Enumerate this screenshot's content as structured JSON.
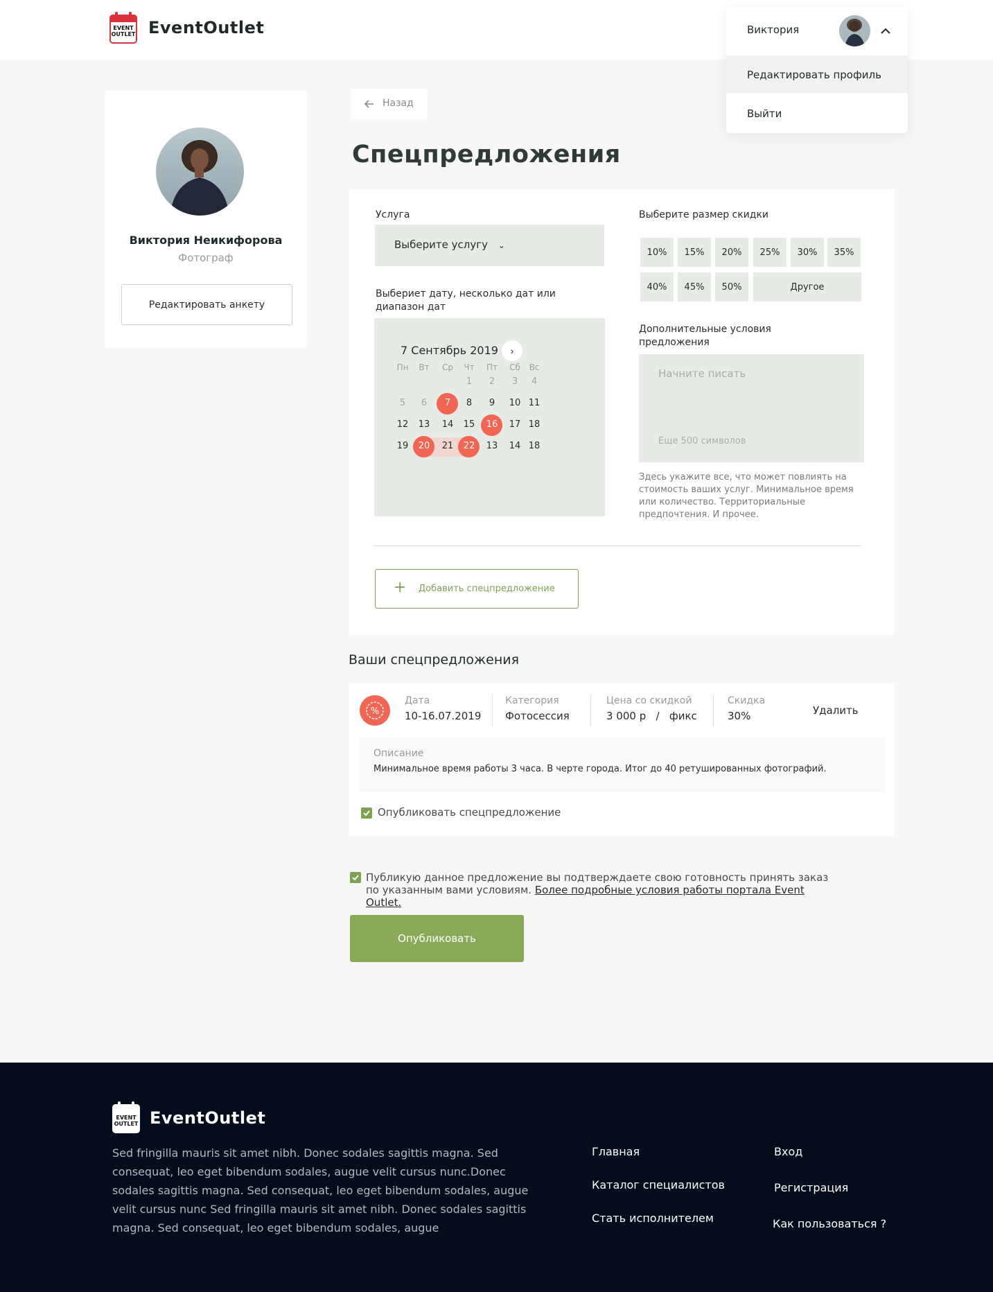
{
  "header": {
    "logo_text": "EventOutlet",
    "logo_badge": "EVENT OUTLET"
  },
  "profile_menu": {
    "name": "Виктория",
    "items": [
      "Редактировать профиль",
      "Выйти"
    ]
  },
  "sidebar": {
    "name": "Виктория Неикифорова",
    "role": "Фотограф",
    "edit_button": "Редактировать анкету"
  },
  "back_label": "Назад",
  "page_title": "Спецпредложения",
  "form": {
    "service_label": "Услуга",
    "service_placeholder": "Выберите услугу",
    "date_label": "Выбериет дату, несколько дат или диапазон дат",
    "calendar": {
      "title": "7 Сентябрь 2019",
      "weekdays": [
        "Пн",
        "Вт",
        "Ср",
        "Чт",
        "Пт",
        "Сб",
        "Вс"
      ],
      "rows": [
        [
          "",
          "",
          "",
          "1",
          "2",
          "3",
          "4"
        ],
        [
          "5",
          "6",
          "7",
          "8",
          "9",
          "10",
          "11"
        ],
        [
          "12",
          "13",
          "14",
          "15",
          "16",
          "17",
          "18"
        ],
        [
          "19",
          "20",
          "21",
          "22",
          "13",
          "14",
          "18"
        ]
      ],
      "selected": [
        "7",
        "16",
        "20",
        "22"
      ],
      "range": [
        "20",
        "22"
      ]
    },
    "discount_label": "Выберите размер скидки",
    "discounts": [
      "10%",
      "15%",
      "20%",
      "25%",
      "30%",
      "35%",
      "40%",
      "45%",
      "50%",
      "Другое"
    ],
    "conditions_label": "Дополнительные условия предложения",
    "conditions_placeholder": "Начните писать",
    "conditions_counter": "Еще 500 символов",
    "conditions_hint": "Здесь укажите все, что может повлиять на стоимость ваших услуг. Минимальное время или количество.  Территориальные предпочтения. И прочее.",
    "add_button": "Добавить спецпредложение"
  },
  "offers_title": "Ваши спецпредложения",
  "offer": {
    "date_label": "Дата",
    "date_value": "10-16.07.2019",
    "category_label": "Категория",
    "category_value": "Фотосессия",
    "price_label": "Цена со скидкой",
    "price_value": "3 000 р   /   фикс",
    "discount_label": "Скидка",
    "discount_value": "30%",
    "delete_label": "Удалить",
    "description_label": "Описание",
    "description_value": "Минимальное время работы 3 часа. В черте города. Итог до 40 ретушированных фотографий.",
    "publish_checkbox": "Опубликовать спецпредложение"
  },
  "confirm": {
    "text_line1": "Публикую данное предложение вы подтверждаете свою готовность принять заказ",
    "text_line2": "по указанным вами условиям.",
    "link": "Более подробные условия работы портала Event Outlet."
  },
  "publish_button": "Опубликовать",
  "footer": {
    "logo_text": "EventOutlet",
    "description": "Sed fringilla mauris sit amet nibh. Donec sodales sagittis magna. Sed consequat, leo eget bibendum sodales, augue velit cursus nunc.Donec sodales sagittis magna. Sed consequat, leo eget bibendum sodales, augue velit cursus nunc Sed fringilla mauris sit amet nibh. Donec sodales sagittis magna. Sed consequat, leo eget bibendum sodales, augue",
    "links_col1": [
      "Главная",
      "Каталог специалистов",
      "Стать исполнителем"
    ],
    "links_col2": [
      "Вход",
      "Регистрация",
      "Как пользоваться ?"
    ]
  },
  "colors": {
    "accent_green": "#8aaa5a",
    "accent_red": "#f26552",
    "field_bg": "#e6ebe5",
    "footer_bg": "#050c1d"
  }
}
